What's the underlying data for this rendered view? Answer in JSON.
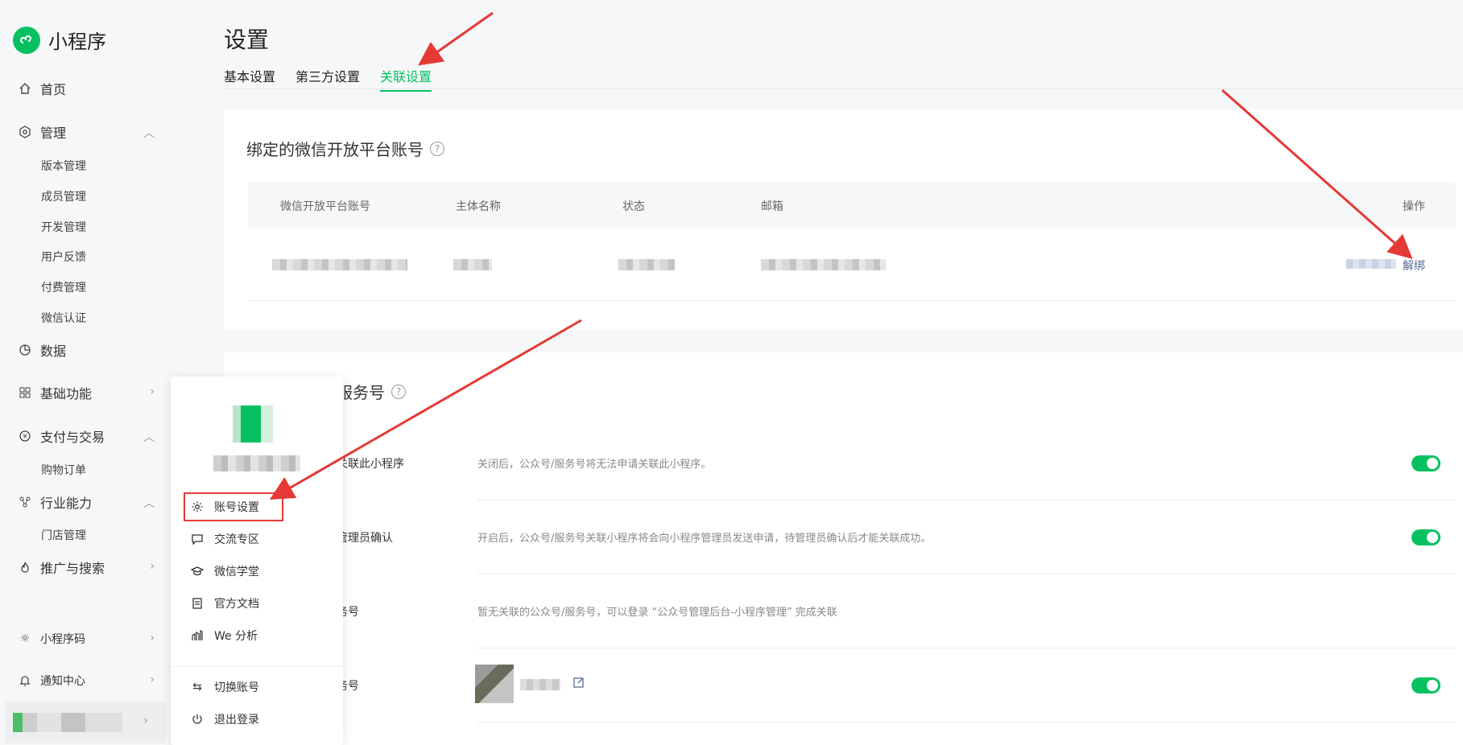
{
  "app": {
    "name": "小程序"
  },
  "sidebar": {
    "items": [
      {
        "label": "首页",
        "icon": "home-icon"
      },
      {
        "label": "管理",
        "icon": "settings-hex-icon",
        "expanded": true,
        "children": [
          "版本管理",
          "成员管理",
          "开发管理",
          "用户反馈",
          "付费管理",
          "微信认证"
        ]
      },
      {
        "label": "数据",
        "icon": "pie-chart-icon"
      },
      {
        "label": "基础功能",
        "icon": "grid-icon",
        "expanded": false
      },
      {
        "label": "支付与交易",
        "icon": "yen-icon",
        "expanded": true,
        "children": [
          "购物订单"
        ]
      },
      {
        "label": "行业能力",
        "icon": "nodes-icon",
        "expanded": true,
        "children": [
          "门店管理"
        ]
      },
      {
        "label": "推广与搜索",
        "icon": "flame-icon",
        "expanded": false
      }
    ],
    "bottom": [
      {
        "label": "小程序码",
        "icon": "sun-icon"
      },
      {
        "label": "通知中心",
        "icon": "bell-icon"
      }
    ]
  },
  "page": {
    "title": "设置",
    "tabs": [
      {
        "label": "基本设置",
        "active": false
      },
      {
        "label": "第三方设置",
        "active": false
      },
      {
        "label": "关联设置",
        "active": true
      }
    ]
  },
  "open_platform": {
    "title": "绑定的微信开放平台账号",
    "columns": [
      "微信开放平台账号",
      "主体名称",
      "状态",
      "邮箱",
      "操作"
    ],
    "action": "解绑"
  },
  "service": {
    "title_visible": "服务号",
    "rows": [
      {
        "label": "关联此小程序",
        "desc": "关闭后，公众号/服务号将无法申请关联此小程序。",
        "toggle": true
      },
      {
        "label": "管理员确认",
        "desc": "开启后，公众号/服务号关联小程序将会向小程序管理员发送申请，待管理员确认后才能关联成功。",
        "toggle": true
      },
      {
        "label": "务号",
        "desc": "暂无关联的公众号/服务号，可以登录 “公众号管理后台-小程序管理” 完成关联"
      },
      {
        "label": "务号",
        "toggle": true
      }
    ]
  },
  "popup": {
    "items": [
      {
        "label": "账号设置",
        "icon": "gear-icon"
      },
      {
        "label": "交流专区",
        "icon": "chat-icon"
      },
      {
        "label": "微信学堂",
        "icon": "graduation-cap-icon"
      },
      {
        "label": "官方文档",
        "icon": "document-icon"
      },
      {
        "label": "We 分析",
        "icon": "chart-bars-icon"
      },
      {
        "label": "切换账号",
        "icon": "switch-icon"
      },
      {
        "label": "退出登录",
        "icon": "power-icon"
      }
    ]
  },
  "colors": {
    "accent": "#07c160",
    "link": "#576b95",
    "annotation": "#e53935"
  }
}
